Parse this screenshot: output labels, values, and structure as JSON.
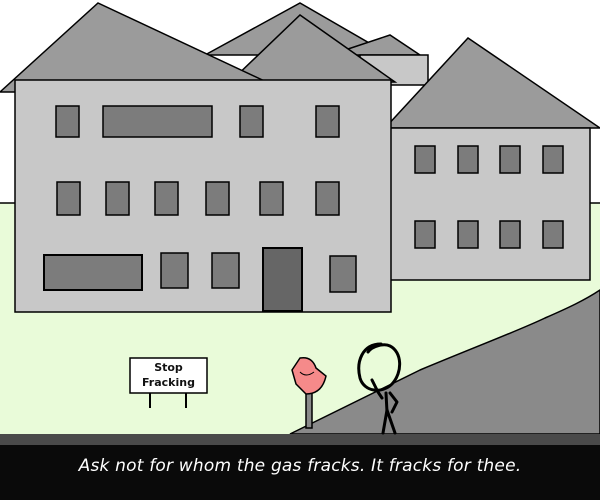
{
  "sign": {
    "line1": "Stop",
    "line2": "Fracking"
  },
  "caption": "Ask not for whom the gas fracks. It fracks for thee.",
  "colors": {
    "sky": "#ffffff",
    "grass": "#e9fbd9",
    "roof": "#9b9b9b",
    "wall": "#c8c8c8",
    "window": "#7c7c7c",
    "door": "#666666",
    "road": "#8a8a8a",
    "mailbox": "#f58a8a",
    "caption_bg": "#0a0a0a"
  }
}
